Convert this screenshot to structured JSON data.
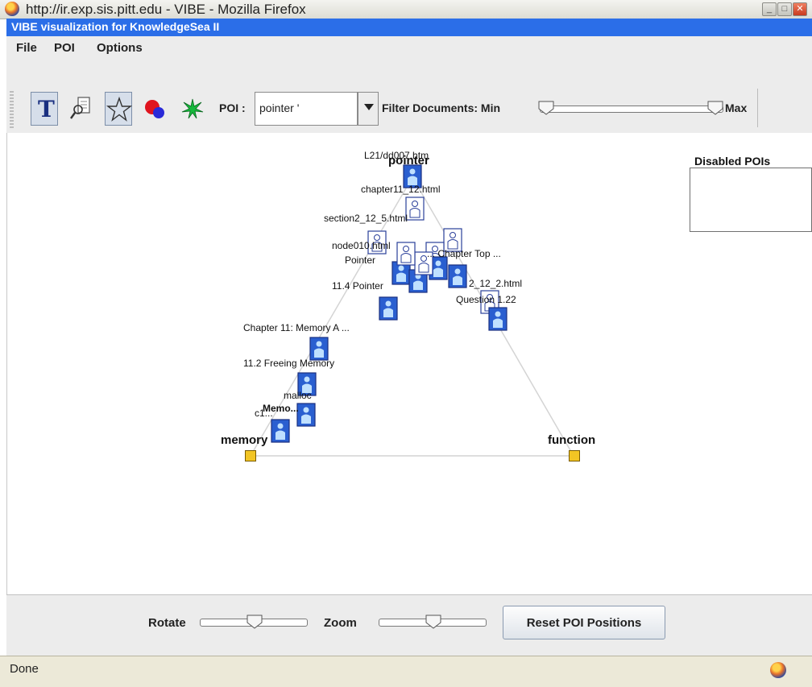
{
  "window": {
    "title": "http://ir.exp.sis.pitt.edu - VIBE - Mozilla Firefox",
    "buttons": {
      "minimize": "_",
      "maximize": "□",
      "close": "✕"
    }
  },
  "applet": {
    "title": "VIBE visualization for KnowledgeSea II"
  },
  "menu": {
    "items": [
      "File",
      "POI",
      "Options"
    ]
  },
  "toolbar": {
    "tool_icons": [
      "text-tool-icon",
      "magnifier-document-icon",
      "star-icon",
      "color-icon",
      "burst-icon"
    ],
    "text_tool_glyph": "T",
    "poi_label": "POI :",
    "poi_selected": "pointer '",
    "filter_label": "Filter Documents: Min",
    "filter_max_label": "Max",
    "filter_range": {
      "min": 0.0,
      "max": 1.0
    }
  },
  "visualization": {
    "pois": [
      {
        "name": "pointer"
      },
      {
        "name": "memory"
      },
      {
        "name": "function"
      }
    ],
    "document_labels": [
      "L21/dd007.htm",
      "chapter11_12.html",
      "section2_12_5.html",
      "node010.html",
      "Pointer",
      "... Chapter Top ...",
      "11.4 Pointer",
      "2_12_2.html",
      "Question 1.22",
      "Chapter 11: Memory A ...",
      "11.2 Freeing Memory",
      "malloc",
      "Memo...",
      "c1..."
    ],
    "disabled_pois_title": "Disabled POIs",
    "disabled_pois": []
  },
  "controls": {
    "rotate_label": "Rotate",
    "zoom_label": "Zoom",
    "rotate_value": 0.5,
    "zoom_value": 0.5,
    "reset_button": "Reset POI Positions"
  },
  "status": {
    "text": "Done"
  },
  "colors": {
    "applet_title_bar": "#2b6ee8",
    "document_icon": "#2a5fd0",
    "poi_anchor": "#f2c524",
    "triangle_lines": "#d4d4d4"
  }
}
